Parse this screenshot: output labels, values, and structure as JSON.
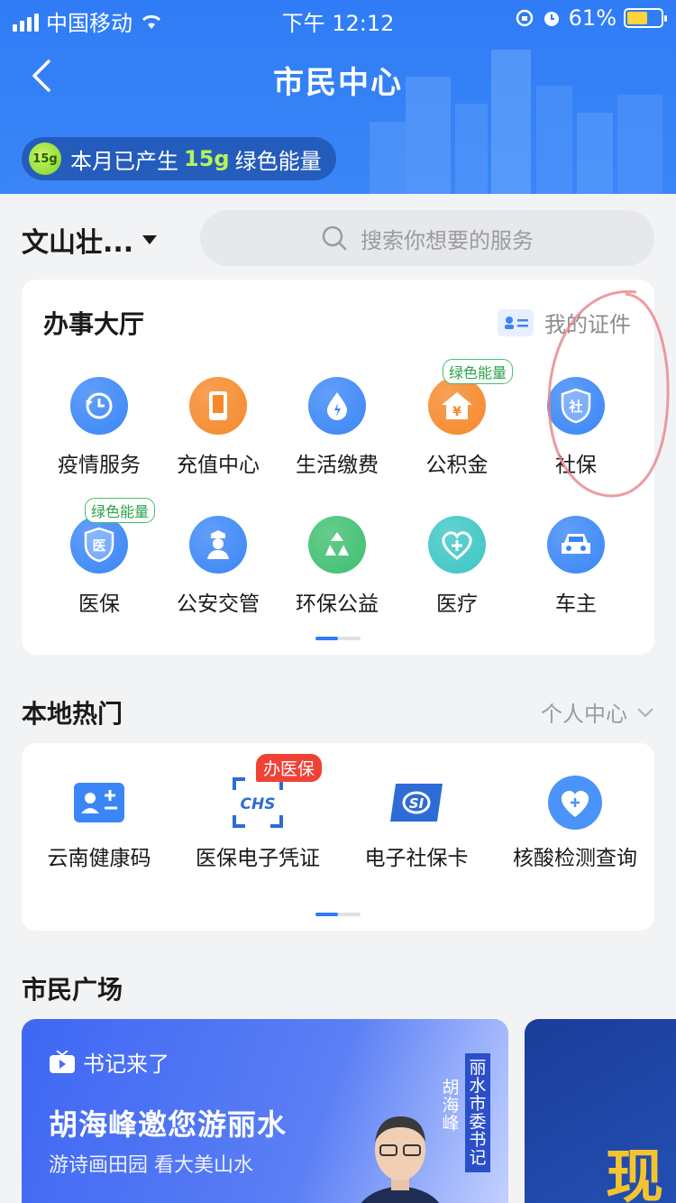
{
  "status_bar": {
    "carrier": "中国移动",
    "time": "下午 12:12",
    "battery_pct": "61%",
    "battery_level": 0.61
  },
  "header": {
    "title": "市民中心",
    "energy_prefix": "本月已产生",
    "energy_value": "15g",
    "energy_suffix": "绿色能量",
    "energy_badge": "15g"
  },
  "location": {
    "name": "文山壮..."
  },
  "search": {
    "placeholder": "搜索你想要的服务"
  },
  "hall": {
    "title": "办事大厅",
    "my_cert": "我的证件",
    "services": [
      {
        "label": "疫情服务",
        "icon": "clock-refresh-icon",
        "color": "#3a86f7"
      },
      {
        "label": "充值中心",
        "icon": "phone-icon",
        "color": "#f5892b"
      },
      {
        "label": "生活缴费",
        "icon": "water-drop-icon",
        "color": "#3a86f7"
      },
      {
        "label": "公积金",
        "icon": "house-yuan-icon",
        "color": "#f5892b",
        "tag": "绿色能量"
      },
      {
        "label": "社保",
        "icon": "shield-she-icon",
        "color": "#3a86f7",
        "glyph": "社"
      },
      {
        "label": "医保",
        "icon": "shield-yi-icon",
        "color": "#3a86f7",
        "glyph": "医",
        "tag": "绿色能量"
      },
      {
        "label": "公安交管",
        "icon": "police-icon",
        "color": "#3a86f7"
      },
      {
        "label": "环保公益",
        "icon": "recycle-icon",
        "color": "#3fbf70"
      },
      {
        "label": "医疗",
        "icon": "medical-heart-icon",
        "color": "#3cc6c4"
      },
      {
        "label": "车主",
        "icon": "car-icon",
        "color": "#3a86f7"
      }
    ]
  },
  "hot": {
    "title": "本地热门",
    "personal": "个人中心",
    "items": [
      {
        "label": "云南健康码",
        "icon": "health-card-icon"
      },
      {
        "label": "医保电子凭证",
        "icon": "chs-icon",
        "badge": "办医保",
        "icon_text": "CHS"
      },
      {
        "label": "电子社保卡",
        "icon": "si-card-icon",
        "icon_text": "SI"
      },
      {
        "label": "核酸检测查询",
        "icon": "heart-plus-icon"
      }
    ]
  },
  "plaza": {
    "title": "市民广场",
    "banner": {
      "tag": "书记来了",
      "title": "胡海峰邀您游丽水",
      "subtitle": "游诗画田园 看大美山水",
      "vtext1": "丽水市委书记",
      "vtext2": "胡海峰"
    },
    "banner2_text": "现"
  },
  "colors": {
    "primary": "#2f7cf6",
    "green_tag": "#43c165",
    "red_badge": "#f04135"
  }
}
